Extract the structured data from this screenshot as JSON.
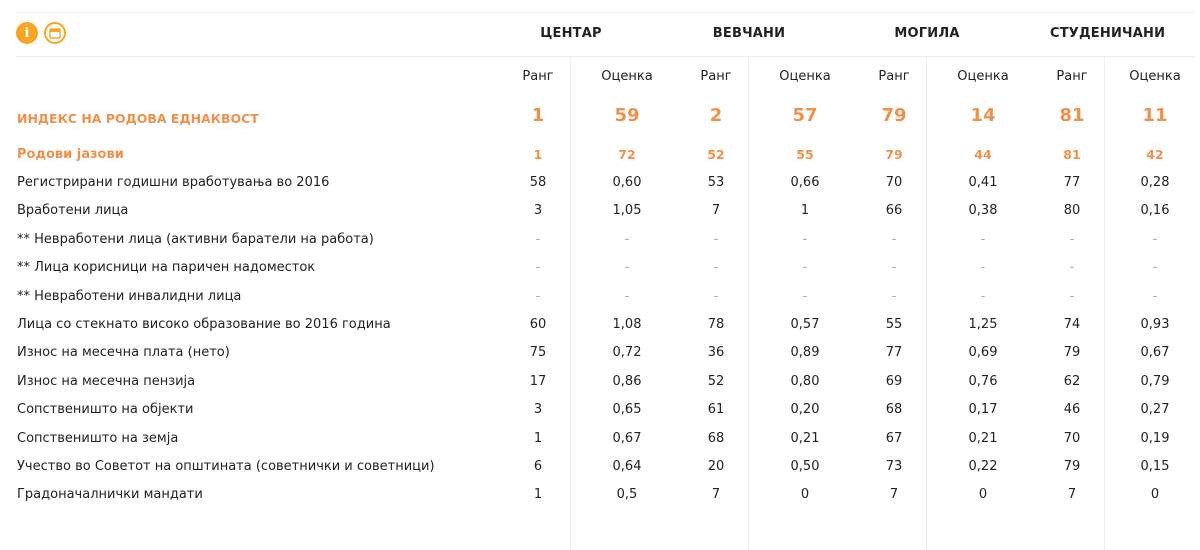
{
  "header": {
    "icons": [
      "info-icon",
      "calendar-icon"
    ],
    "municipalities": [
      "ЦЕНТАР",
      "ВЕВЧАНИ",
      "МОГИЛА",
      "СТУДЕНИЧАНИ"
    ]
  },
  "subheader": {
    "rank_label": "Ранг",
    "score_label": "Оценка"
  },
  "colors": {
    "accent": "#f0914a",
    "icon": "#f6a623"
  },
  "rows": [
    {
      "label": "ИНДЕКС НА РОДОВА ЕДНАКВОСТ",
      "type": "index",
      "values": [
        "1",
        "59",
        "2",
        "57",
        "79",
        "14",
        "81",
        "11"
      ]
    },
    {
      "label": "Родови јазови",
      "type": "gap",
      "values": [
        "1",
        "72",
        "52",
        "55",
        "79",
        "44",
        "81",
        "42"
      ]
    },
    {
      "label": "Регистрирани годишни вработувања во 2016",
      "type": "normal",
      "values": [
        "58",
        "0,60",
        "53",
        "0,66",
        "70",
        "0,41",
        "77",
        "0,28"
      ]
    },
    {
      "label": "Вработени лица",
      "type": "normal",
      "values": [
        "3",
        "1,05",
        "7",
        "1",
        "66",
        "0,38",
        "80",
        "0,16"
      ]
    },
    {
      "label": "** Невработени лица (активни баратели на работа)",
      "type": "normal",
      "values": [
        "-",
        "-",
        "-",
        "-",
        "-",
        "-",
        "-",
        "-"
      ]
    },
    {
      "label": "** Лица корисници на паричен надоместок",
      "type": "normal",
      "values": [
        "-",
        "-",
        "-",
        "-",
        "-",
        "-",
        "-",
        "-"
      ]
    },
    {
      "label": "** Невработени инвалидни лица",
      "type": "normal",
      "values": [
        "-",
        "-",
        "-",
        "-",
        "-",
        "-",
        "-",
        "-"
      ]
    },
    {
      "label": "Лица со стекнато високо образование во 2016 година",
      "type": "normal",
      "values": [
        "60",
        "1,08",
        "78",
        "0,57",
        "55",
        "1,25",
        "74",
        "0,93"
      ]
    },
    {
      "label": "Износ на месечна плата (нето)",
      "type": "normal",
      "values": [
        "75",
        "0,72",
        "36",
        "0,89",
        "77",
        "0,69",
        "79",
        "0,67"
      ]
    },
    {
      "label": "Износ на месечна пензија",
      "type": "normal",
      "values": [
        "17",
        "0,86",
        "52",
        "0,80",
        "69",
        "0,76",
        "62",
        "0,79"
      ]
    },
    {
      "label": "Сопственишто на објекти",
      "type": "normal",
      "values": [
        "3",
        "0,65",
        "61",
        "0,20",
        "68",
        "0,17",
        "46",
        "0,27"
      ]
    },
    {
      "label": "Сопственишто на земја",
      "type": "normal",
      "values": [
        "1",
        "0,67",
        "68",
        "0,21",
        "67",
        "0,21",
        "70",
        "0,19"
      ]
    },
    {
      "label": "Учество во Советот на општината (советнички и советници)",
      "type": "normal",
      "values": [
        "6",
        "0,64",
        "20",
        "0,50",
        "73",
        "0,22",
        "79",
        "0,15"
      ]
    },
    {
      "label": "Градоначалнички мандати",
      "type": "normal",
      "values": [
        "1",
        "0,5",
        "7",
        "0",
        "7",
        "0",
        "7",
        "0"
      ]
    }
  ]
}
